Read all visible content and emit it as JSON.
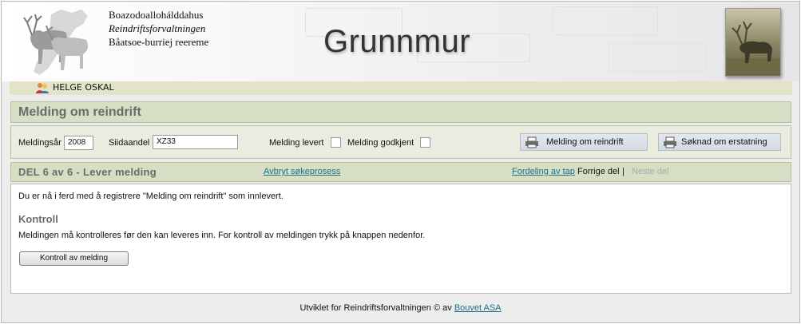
{
  "header": {
    "org_lines": [
      "Boazodoallohálddahus",
      "Reindriftsforvaltningen",
      "Båatsoe-burriej reereme"
    ],
    "app_title": "Grunnmur"
  },
  "user": {
    "name": "HELGE OSKAL"
  },
  "page": {
    "title": "Melding om reindrift"
  },
  "filters": {
    "year_label": "Meldingsår",
    "year_value": "2008",
    "siida_label": "Siidaandel",
    "siida_value": "XZ33",
    "delivered_label": "Melding levert",
    "approved_label": "Melding godkjent",
    "print_report_label": "Melding om reindrift",
    "print_claim_label": "Søknad om erstatning"
  },
  "step": {
    "title": "DEL 6 av 6 - Lever melding",
    "cancel_link": "Avbryt søkeprosess",
    "distribution_link": "Fordeling av tap",
    "prev_label": "Forrige del",
    "separator": "|",
    "next_label": "Neste del"
  },
  "content": {
    "intro": "Du er nå i ferd med å registrere \"Melding om reindrift\" som innlevert.",
    "heading": "Kontroll",
    "text": "Meldingen må kontrolleres før den kan leveres inn. For kontroll av meldingen trykk på knappen nedenfor.",
    "check_button": "Kontroll av melding"
  },
  "footer": {
    "text": "Utviklet for Reindriftsforvaltningen © av",
    "link": "Bouvet ASA"
  }
}
